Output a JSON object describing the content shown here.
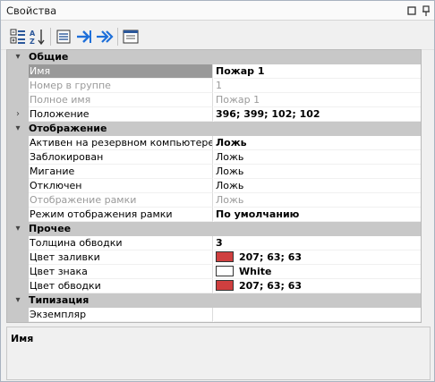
{
  "window": {
    "title": "Свойства",
    "pin_glyph": "◻",
    "close_glyph": "📌"
  },
  "toolbar": {
    "buttons": [
      {
        "icon": "categorized-icon"
      },
      {
        "icon": "sort-alpha-icon"
      },
      {
        "icon": "properties-list-icon"
      },
      {
        "icon": "go-to-icon"
      },
      {
        "icon": "go-to-all-icon"
      },
      {
        "icon": "property-pages-icon"
      }
    ]
  },
  "grid": {
    "categories": [
      {
        "label": "Общие",
        "toggle": "▾",
        "rows": [
          {
            "name": "Имя",
            "value": "Пожар 1",
            "value_style": "bold",
            "selected": true
          },
          {
            "name": "Номер в группе",
            "value": "1",
            "name_style": "dim",
            "value_style": "dim"
          },
          {
            "name": "Полное имя",
            "value": "Пожар 1",
            "name_style": "dim",
            "value_style": "dim"
          },
          {
            "name": "Положение",
            "value": "396; 399; 102; 102",
            "value_style": "bold",
            "toggle": "›"
          }
        ]
      },
      {
        "label": "Отображение",
        "toggle": "▾",
        "rows": [
          {
            "name": "Активен на резервном компьютере",
            "value": "Ложь",
            "value_style": "bold"
          },
          {
            "name": "Заблокирован",
            "value": "Ложь"
          },
          {
            "name": "Мигание",
            "value": "Ложь"
          },
          {
            "name": "Отключен",
            "value": "Ложь"
          },
          {
            "name": "Отображение рамки",
            "value": "Ложь",
            "name_style": "dim",
            "value_style": "dim"
          },
          {
            "name": "Режим отображения рамки",
            "value": "По умолчанию",
            "value_style": "bold"
          }
        ]
      },
      {
        "label": "Прочее",
        "toggle": "▾",
        "rows": [
          {
            "name": "Толщина обводки",
            "value": "3",
            "value_style": "bold"
          },
          {
            "name": "Цвет заливки",
            "value": "207; 63; 63",
            "value_style": "bold",
            "swatch": "#cf3f3f"
          },
          {
            "name": "Цвет знака",
            "value": "White",
            "value_style": "bold",
            "swatch": "#ffffff"
          },
          {
            "name": "Цвет обводки",
            "value": "207; 63; 63",
            "value_style": "bold",
            "swatch": "#cf3f3f"
          }
        ]
      },
      {
        "label": "Типизация",
        "toggle": "▾",
        "rows": [
          {
            "name": "Экземпляр",
            "value": ""
          }
        ]
      }
    ]
  },
  "scrollbar": {
    "up_glyph": "▲",
    "down_glyph": "▼"
  },
  "description": {
    "title": "Имя"
  }
}
